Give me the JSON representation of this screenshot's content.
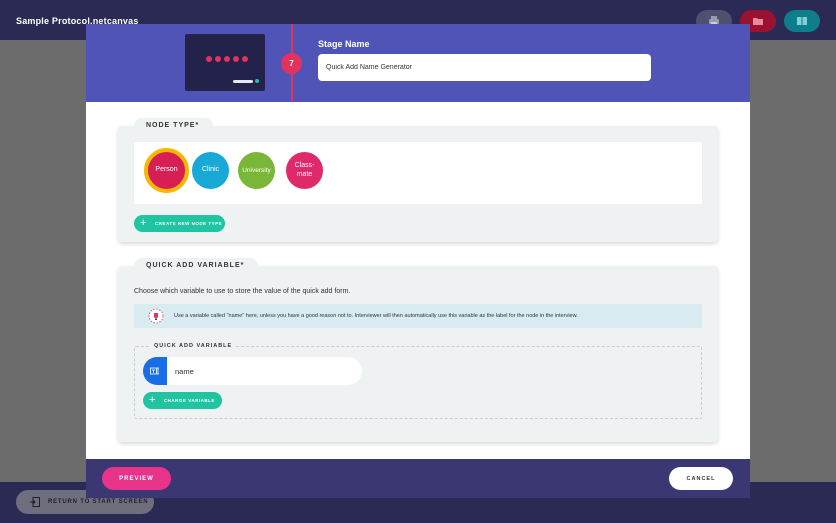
{
  "app": {
    "title": "Sample Protocol.netcanvas",
    "return_label": "RETURN TO START SCREEN"
  },
  "header_actions": [
    "print-icon",
    "folder-icon",
    "book-icon"
  ],
  "stage": {
    "number": "7",
    "name_label": "Stage Name",
    "name_value": "Quick Add Name Generator"
  },
  "node_type": {
    "section_label": "NODE TYPE*",
    "nodes": [
      {
        "label": "Person",
        "color": "#d81f55",
        "selected": true
      },
      {
        "label": "Clinic",
        "color": "#18a9d6"
      },
      {
        "label": "University",
        "color": "#7ab738"
      },
      {
        "label": "Class-mate",
        "color": "#e0296a"
      }
    ],
    "create_button": "CREATE NEW NODE TYPE"
  },
  "quick_add": {
    "section_label": "QUICK ADD VARIABLE*",
    "description": "Choose which variable to use to store the value of the quick add form.",
    "tip": "Use a variable called \"name\" here, unless you have a good reason not to. Interviewer will then automatically use this variable as the label for the node in the interview.",
    "field_label": "QUICK ADD VARIABLE",
    "variable_name": "name",
    "change_button": "CHANGE VARIABLE"
  },
  "footer": {
    "preview": "PREVIEW",
    "cancel": "CANCEL"
  },
  "colors": {
    "accent_purple": "#4f54b6",
    "navy": "#2b2a55",
    "primary_pink": "#e2335e",
    "teal": "#20c4a1",
    "blue": "#1a6ee5"
  }
}
